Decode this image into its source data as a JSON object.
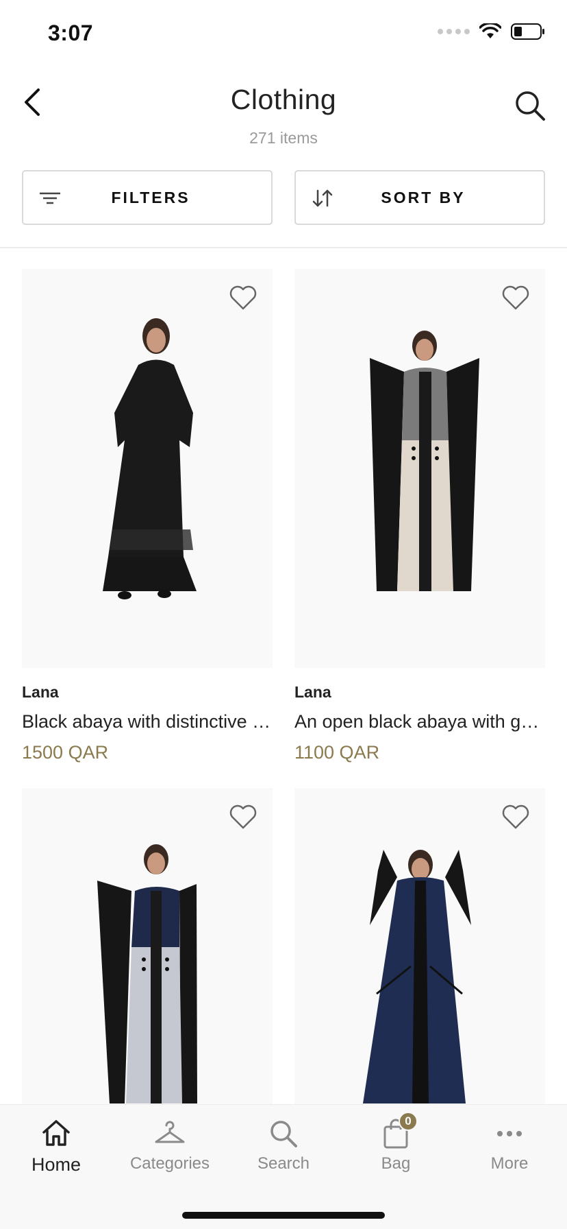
{
  "status_bar": {
    "time": "3:07"
  },
  "header": {
    "title": "Clothing",
    "item_count": "271 items",
    "back_icon": "chevron-left-icon",
    "search_icon": "search-icon"
  },
  "filters": {
    "filters_label": "FILTERS",
    "sort_label": "SORT BY"
  },
  "products": [
    {
      "brand": "Lana",
      "name": "Black abaya with distinctive embroidery",
      "price": "1500 QAR"
    },
    {
      "brand": "Lana",
      "name": "An open black abaya with grey and beige panels",
      "price": "1100 QAR"
    },
    {
      "brand": "",
      "name": "",
      "price": ""
    },
    {
      "brand": "",
      "name": "",
      "price": ""
    }
  ],
  "tab_bar": {
    "tabs": [
      {
        "label": "Home",
        "icon": "home-icon",
        "active": true
      },
      {
        "label": "Categories",
        "icon": "hanger-icon",
        "active": false
      },
      {
        "label": "Search",
        "icon": "search-icon",
        "active": false
      },
      {
        "label": "Bag",
        "icon": "bag-icon",
        "active": false,
        "badge": "0"
      },
      {
        "label": "More",
        "icon": "more-icon",
        "active": false
      }
    ]
  },
  "colors": {
    "price": "#8a7a4e",
    "badge": "#8a7a4e",
    "border": "#d9d9d9"
  }
}
